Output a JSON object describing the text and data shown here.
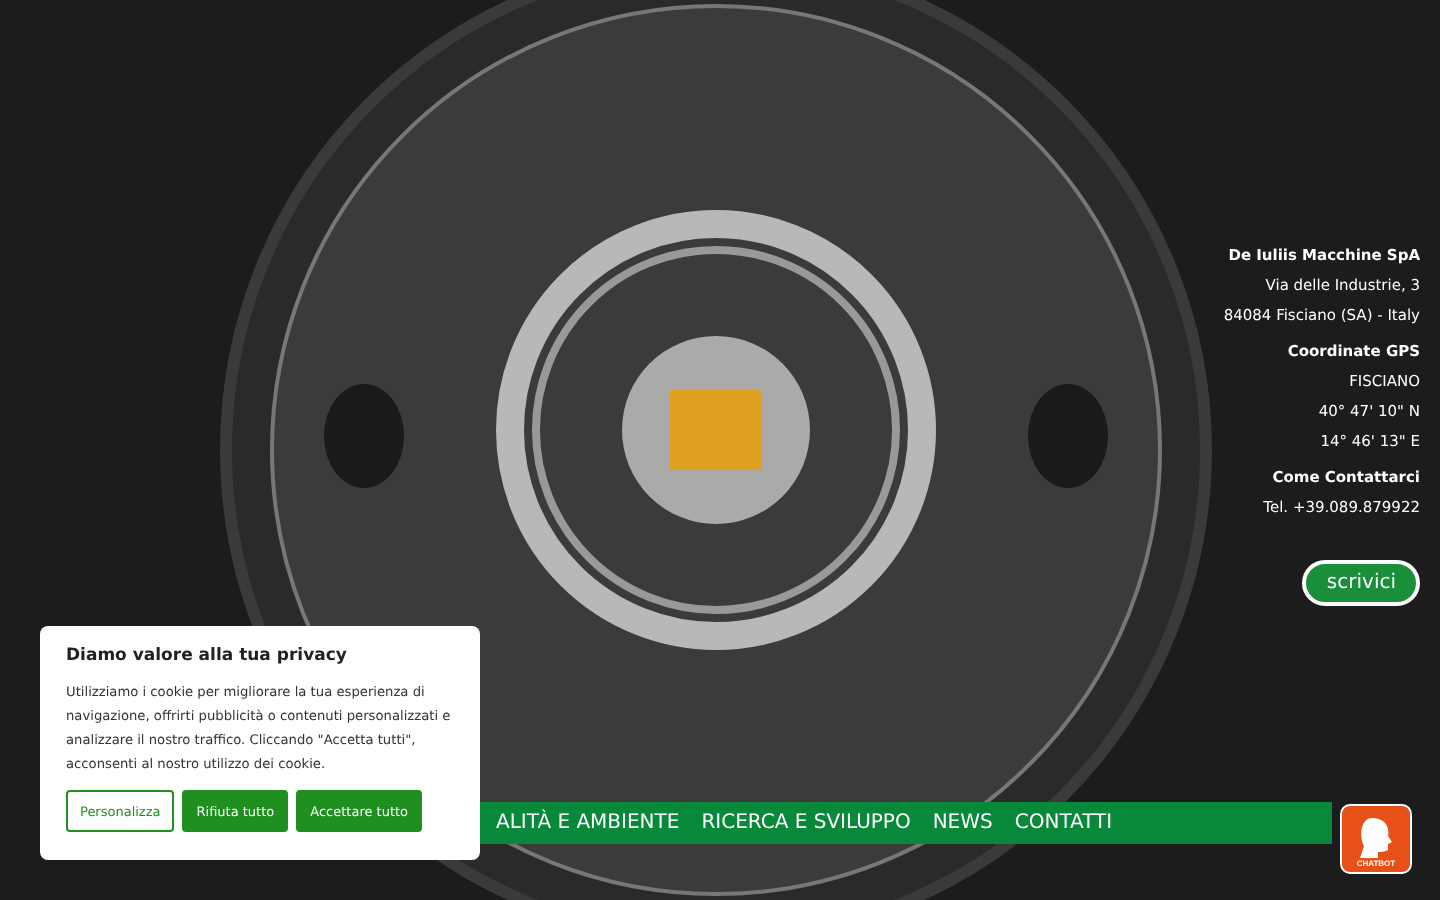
{
  "company_info": [
    {
      "title": "De Iuliis Macchine SpA",
      "lines": [
        "Via delle Industrie, 3",
        "84084 Fisciano (SA) - Italy"
      ]
    },
    {
      "title": "Coordinate GPS",
      "lines": [
        "FISCIANO",
        "40° 47' 10\" N",
        "14° 46' 13\" E"
      ]
    },
    {
      "title": "Come Contattarci",
      "lines": [
        "Tel. +39.089.879922"
      ]
    }
  ],
  "contact_button": {
    "label": "scrivici"
  },
  "nav": {
    "items": [
      "ALITÀ E AMBIENTE",
      "RICERCA E SVILUPPO",
      "NEWS",
      "CONTATTI"
    ]
  },
  "chatbot": {
    "label": "CHATBOT"
  },
  "cookie_banner": {
    "title": "Diamo valore alla tua privacy",
    "text": "Utilizziamo i cookie per migliorare la tua esperienza di navigazione, offrirti pubblicità o contenuti personalizzati e analizzare il nostro traffico. Cliccando \"Accetta tutti\", acconsenti al nostro utilizzo dei cookie.",
    "buttons": [
      {
        "label": "Personalizza",
        "kind": "outline"
      },
      {
        "label": "Rifiuta tutto",
        "kind": "filled"
      },
      {
        "label": "Accettare tutto",
        "kind": "filled"
      }
    ]
  }
}
